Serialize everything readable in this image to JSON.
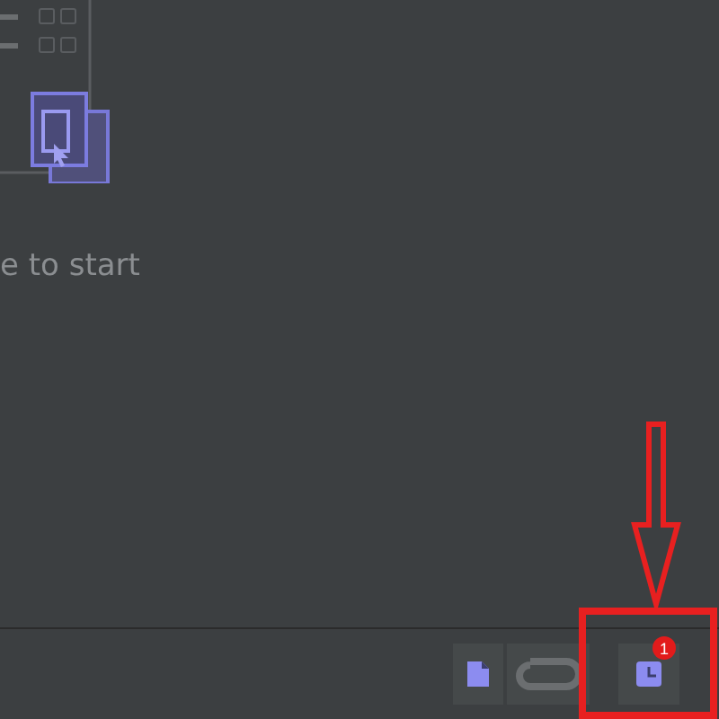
{
  "hint": "e to start",
  "toolbar": [
    {
      "kind": "file"
    },
    {
      "kind": "link"
    },
    {
      "kind": "clock",
      "badge": "1"
    }
  ],
  "annotation": {
    "kind": "arrow-box"
  }
}
